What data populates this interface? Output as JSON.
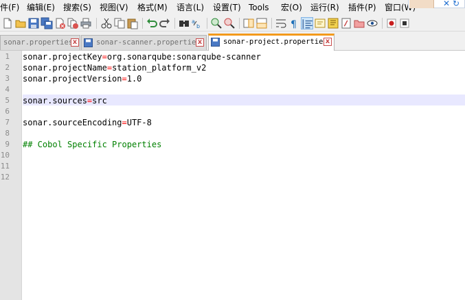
{
  "menubar": {
    "items": [
      "件(F)",
      "编辑(E)",
      "搜索(S)",
      "视图(V)",
      "格式(M)",
      "语言(L)",
      "设置(T)",
      "Tools",
      "宏(O)",
      "运行(R)",
      "插件(P)",
      "窗口(W)"
    ]
  },
  "toolbar": {
    "icons": [
      "new-file-icon",
      "open-file-icon",
      "save-icon",
      "save-all-icon",
      "close-icon",
      "close-all-icon",
      "print-icon",
      "cut-icon",
      "copy-icon",
      "paste-icon",
      "undo-icon",
      "redo-icon",
      "find-icon",
      "replace-icon",
      "zoom-in-icon",
      "zoom-out-icon",
      "sync-vertical-icon",
      "sync-horizontal-icon",
      "word-wrap-icon",
      "show-all-chars-icon",
      "indent-guide-icon",
      "language-icon",
      "doc-map-icon",
      "function-list-icon",
      "folder-workspace-icon",
      "monitor-icon",
      "record-macro-icon",
      "stop-record-icon"
    ]
  },
  "tabs": [
    {
      "label": "sonar.properties",
      "state": "saved",
      "close": "x"
    },
    {
      "label": "sonar-scanner.properties",
      "state": "saved",
      "close": "x"
    },
    {
      "label": "sonar-project.properties",
      "state": "active",
      "close": "x"
    }
  ],
  "editor": {
    "current_line": 5,
    "lines": [
      {
        "number": "1",
        "key": "sonar.projectKey",
        "eq": "=",
        "value": "org.sonarqube:sonarqube-scanner",
        "comment": ""
      },
      {
        "number": "2",
        "key": "sonar.projectName",
        "eq": "=",
        "value": "station_platform_v2",
        "comment": ""
      },
      {
        "number": "3",
        "key": "sonar.projectVersion",
        "eq": "=",
        "value": "1.0",
        "comment": ""
      },
      {
        "number": "4",
        "key": "",
        "eq": "",
        "value": "",
        "comment": ""
      },
      {
        "number": "5",
        "key": "sonar.sources",
        "eq": "=",
        "value": "src",
        "comment": ""
      },
      {
        "number": "6",
        "key": "",
        "eq": "",
        "value": "",
        "comment": ""
      },
      {
        "number": "7",
        "key": "sonar.sourceEncoding",
        "eq": "=",
        "value": "UTF-8",
        "comment": ""
      },
      {
        "number": "8",
        "key": "",
        "eq": "",
        "value": "",
        "comment": ""
      },
      {
        "number": "9",
        "key": "",
        "eq": "",
        "value": "",
        "comment": "## Cobol Specific Properties"
      },
      {
        "number": "10",
        "key": "",
        "eq": "",
        "value": "",
        "comment": ""
      },
      {
        "number": "11",
        "key": "",
        "eq": "",
        "value": "",
        "comment": ""
      },
      {
        "number": "12",
        "key": "",
        "eq": "",
        "value": "",
        "comment": ""
      }
    ]
  },
  "colors": {
    "tab_accent": "#f39a1b",
    "operator": "#ff0000",
    "comment": "#008000",
    "current_line": "#e8e8ff"
  }
}
